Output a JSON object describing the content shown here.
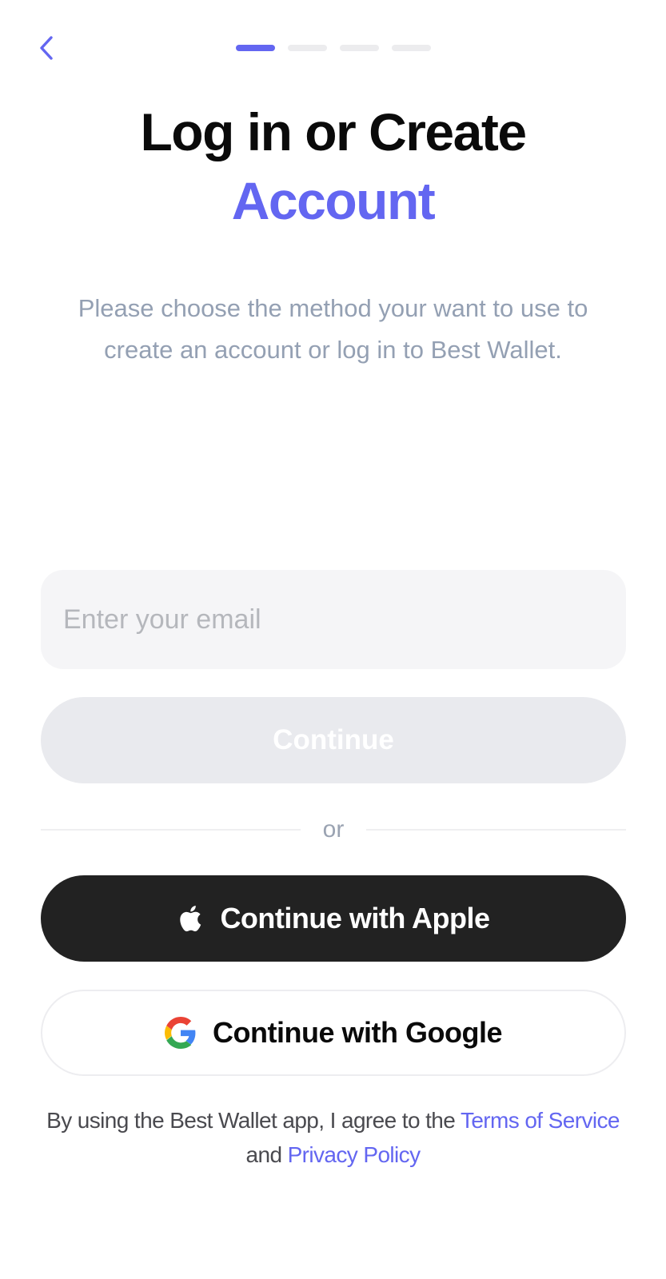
{
  "progress": {
    "total_steps": 4,
    "current_step": 1
  },
  "header": {
    "title_line1": "Log in or Create",
    "title_line2": "Account"
  },
  "subtitle": "Please choose the method your want to use to create an account or log in to Best Wallet.",
  "email": {
    "placeholder": "Enter your email",
    "value": ""
  },
  "continue_button": {
    "label": "Continue",
    "disabled": true
  },
  "divider": {
    "label": "or"
  },
  "apple_button": {
    "label": "Continue with Apple"
  },
  "google_button": {
    "label": "Continue with Google"
  },
  "legal": {
    "prefix": "By using the Best Wallet app, I agree to the",
    "terms_link": "Terms of Service",
    "conjunction": "and",
    "privacy_link": "Privacy Policy"
  },
  "colors": {
    "accent": "#6366f1",
    "apple_button_bg": "#222222",
    "disabled_button_bg": "#e9eaee",
    "input_bg": "#f5f5f7",
    "subtitle_text": "#94a0b3"
  },
  "icons": {
    "back": "chevron-left-icon",
    "apple": "apple-icon",
    "google": "google-icon"
  }
}
